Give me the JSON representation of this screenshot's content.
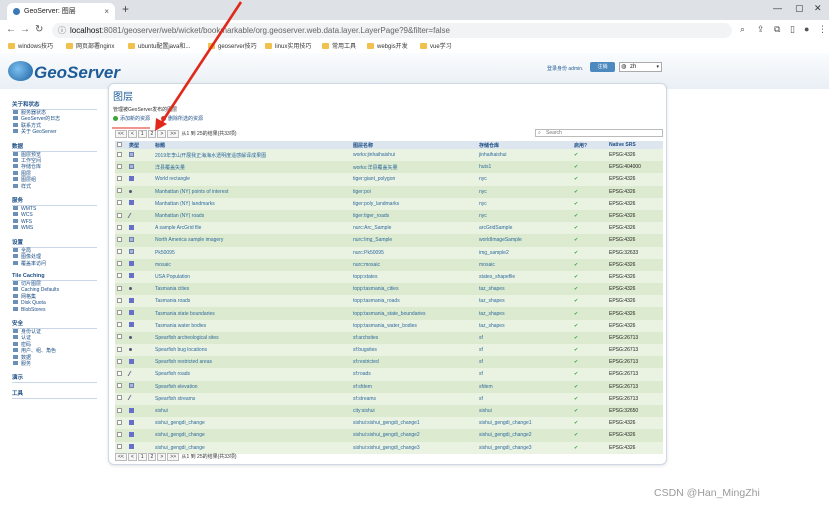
{
  "browser": {
    "tab_title": "GeoServer: 图层",
    "url_host": "localhost",
    "url_rest": ":8081/geoserver/web/wicket/bookmarkable/org.geoserver.web.data.layer.LayerPage?9&filter=false",
    "bookmarks": [
      "windows技巧",
      "网页部署nginx",
      "ubuntu配置java和...",
      "geoserver技巧",
      "linux实用技巧",
      "常用工具",
      "webgis开发",
      "vue学习"
    ]
  },
  "header": {
    "logo_text": "GeoServer",
    "login_text": "登录身份 admin.",
    "logout_label": "注销",
    "lang": "zh"
  },
  "sidebar": {
    "about": {
      "title": "关于和状态",
      "items": [
        "服务器状态",
        "GeoServer的日志",
        "联系方式",
        "关于 GeoServer"
      ]
    },
    "data": {
      "title": "数据",
      "items": [
        "图层预览",
        "工作空间",
        "存储仓库",
        "图层",
        "图层组",
        "样式"
      ]
    },
    "services": {
      "title": "服务",
      "items": [
        "WMTS",
        "WCS",
        "WFS",
        "WMS"
      ]
    },
    "settings": {
      "title": "设置",
      "items": [
        "全局",
        "图像处理",
        "覆盖率访问"
      ]
    },
    "tile": {
      "title": "Tile Caching",
      "items": [
        "切片图层",
        "Caching Defaults",
        "网格集",
        "Disk Quota",
        "BlobStores"
      ]
    },
    "security": {
      "title": "安全",
      "items": [
        "身份认证",
        "认证",
        "密码",
        "用户、组、角色",
        "数据",
        "服务"
      ]
    },
    "demos": {
      "title": "演示"
    },
    "tools": {
      "title": "工具"
    }
  },
  "main": {
    "title": "图层",
    "subtitle": "管理被GeoServer发布的图层",
    "add_label": "添加新的资源",
    "remove_label": "删除所选的资源",
    "pager_pages": [
      "<<",
      "<",
      "1",
      "2",
      ">",
      ">>"
    ],
    "pager_text": "从1 到 25的结果(共33项)",
    "search_placeholder": "Search",
    "columns": [
      "类型",
      "标题",
      "图层名称",
      "存储仓库",
      "启用?",
      "Native SRS"
    ]
  },
  "rows": [
    {
      "type": "rs",
      "title": "2019年李山开展我正海海水透明度遥感解译成果图",
      "name": "works:jinhaihaishui",
      "store": "jinhaihaishui",
      "srs": "EPSG:4326"
    },
    {
      "type": "rs",
      "title": "洋县覆盖矢量",
      "name": "works:洋县覆盖矢量",
      "store": "huts1",
      "srs": "EPSG:404000"
    },
    {
      "type": "poly",
      "title": "World rectangle",
      "name": "tiger:giant_polygon",
      "store": "nyc",
      "srs": "EPSG:4326"
    },
    {
      "type": "pt",
      "title": "Manhattan (NY) points of interest",
      "name": "tiger:poi",
      "store": "nyc",
      "srs": "EPSG:4326"
    },
    {
      "type": "poly",
      "title": "Manhattan (NY) landmarks",
      "name": "tiger:poly_landmarks",
      "store": "nyc",
      "srs": "EPSG:4326"
    },
    {
      "type": "ln",
      "title": "Manhattan (NY) roads",
      "name": "tiger:tiger_roads",
      "store": "nyc",
      "srs": "EPSG:4326"
    },
    {
      "type": "poly",
      "title": "A sample ArcGrid file",
      "name": "nurc:Arc_Sample",
      "store": "arcGridSample",
      "srs": "EPSG:4326"
    },
    {
      "type": "rs",
      "title": "North America sample imagery",
      "name": "nurc:Img_Sample",
      "store": "worldImageSample",
      "srs": "EPSG:4326"
    },
    {
      "type": "rs",
      "title": "Pk50095",
      "name": "nurc:Pk50095",
      "store": "img_sample2",
      "srs": "EPSG:32633"
    },
    {
      "type": "poly",
      "title": "mosaic",
      "name": "nurc:mosaic",
      "store": "mosaic",
      "srs": "EPSG:4326"
    },
    {
      "type": "poly",
      "title": "USA Population",
      "name": "topp:states",
      "store": "states_shapefile",
      "srs": "EPSG:4326"
    },
    {
      "type": "pt",
      "title": "Tasmania cities",
      "name": "topp:tasmania_cities",
      "store": "taz_shapes",
      "srs": "EPSG:4326"
    },
    {
      "type": "poly",
      "title": "Tasmania roads",
      "name": "topp:tasmania_roads",
      "store": "taz_shapes",
      "srs": "EPSG:4326"
    },
    {
      "type": "poly",
      "title": "Tasmania state boundaries",
      "name": "topp:tasmania_state_boundaries",
      "store": "taz_shapes",
      "srs": "EPSG:4326"
    },
    {
      "type": "poly",
      "title": "Tasmania water bodies",
      "name": "topp:tasmania_water_bodies",
      "store": "taz_shapes",
      "srs": "EPSG:4326"
    },
    {
      "type": "pt",
      "title": "Spearfish archeological sites",
      "name": "sf:archsites",
      "store": "sf",
      "srs": "EPSG:26713"
    },
    {
      "type": "pt",
      "title": "Spearfish bug locations",
      "name": "sf:bugsites",
      "store": "sf",
      "srs": "EPSG:26713"
    },
    {
      "type": "poly",
      "title": "Spearfish restricted areas",
      "name": "sf:restricted",
      "store": "sf",
      "srs": "EPSG:26713"
    },
    {
      "type": "ln",
      "title": "Spearfish roads",
      "name": "sf:roads",
      "store": "sf",
      "srs": "EPSG:26713"
    },
    {
      "type": "rs",
      "title": "Spearfish elevation",
      "name": "sf:sfdem",
      "store": "sfdem",
      "srs": "EPSG:26713"
    },
    {
      "type": "ln",
      "title": "Spearfish streams",
      "name": "sf:streams",
      "store": "sf",
      "srs": "EPSG:26713"
    },
    {
      "type": "poly",
      "title": "sishui",
      "name": "city:sishui",
      "store": "sishui",
      "srs": "EPSG:32650"
    },
    {
      "type": "poly",
      "title": "sishui_gengdi_change",
      "name": "sishui:sishui_gengdi_change1",
      "store": "sishui_gengdi_change1",
      "srs": "EPSG:4326"
    },
    {
      "type": "poly",
      "title": "sishui_gengdi_change",
      "name": "sishui:sishui_gengdi_change2",
      "store": "sishui_gengdi_change2",
      "srs": "EPSG:4326"
    },
    {
      "type": "poly",
      "title": "sishui_gengdi_change",
      "name": "sishui:sishui_gengdi_change3",
      "store": "sishui_gengdi_change3",
      "srs": "EPSG:4326"
    }
  ],
  "enabled_mark": "✔",
  "watermark": "CSDN @Han_MingZhi",
  "arrow_color": "#e0291b"
}
